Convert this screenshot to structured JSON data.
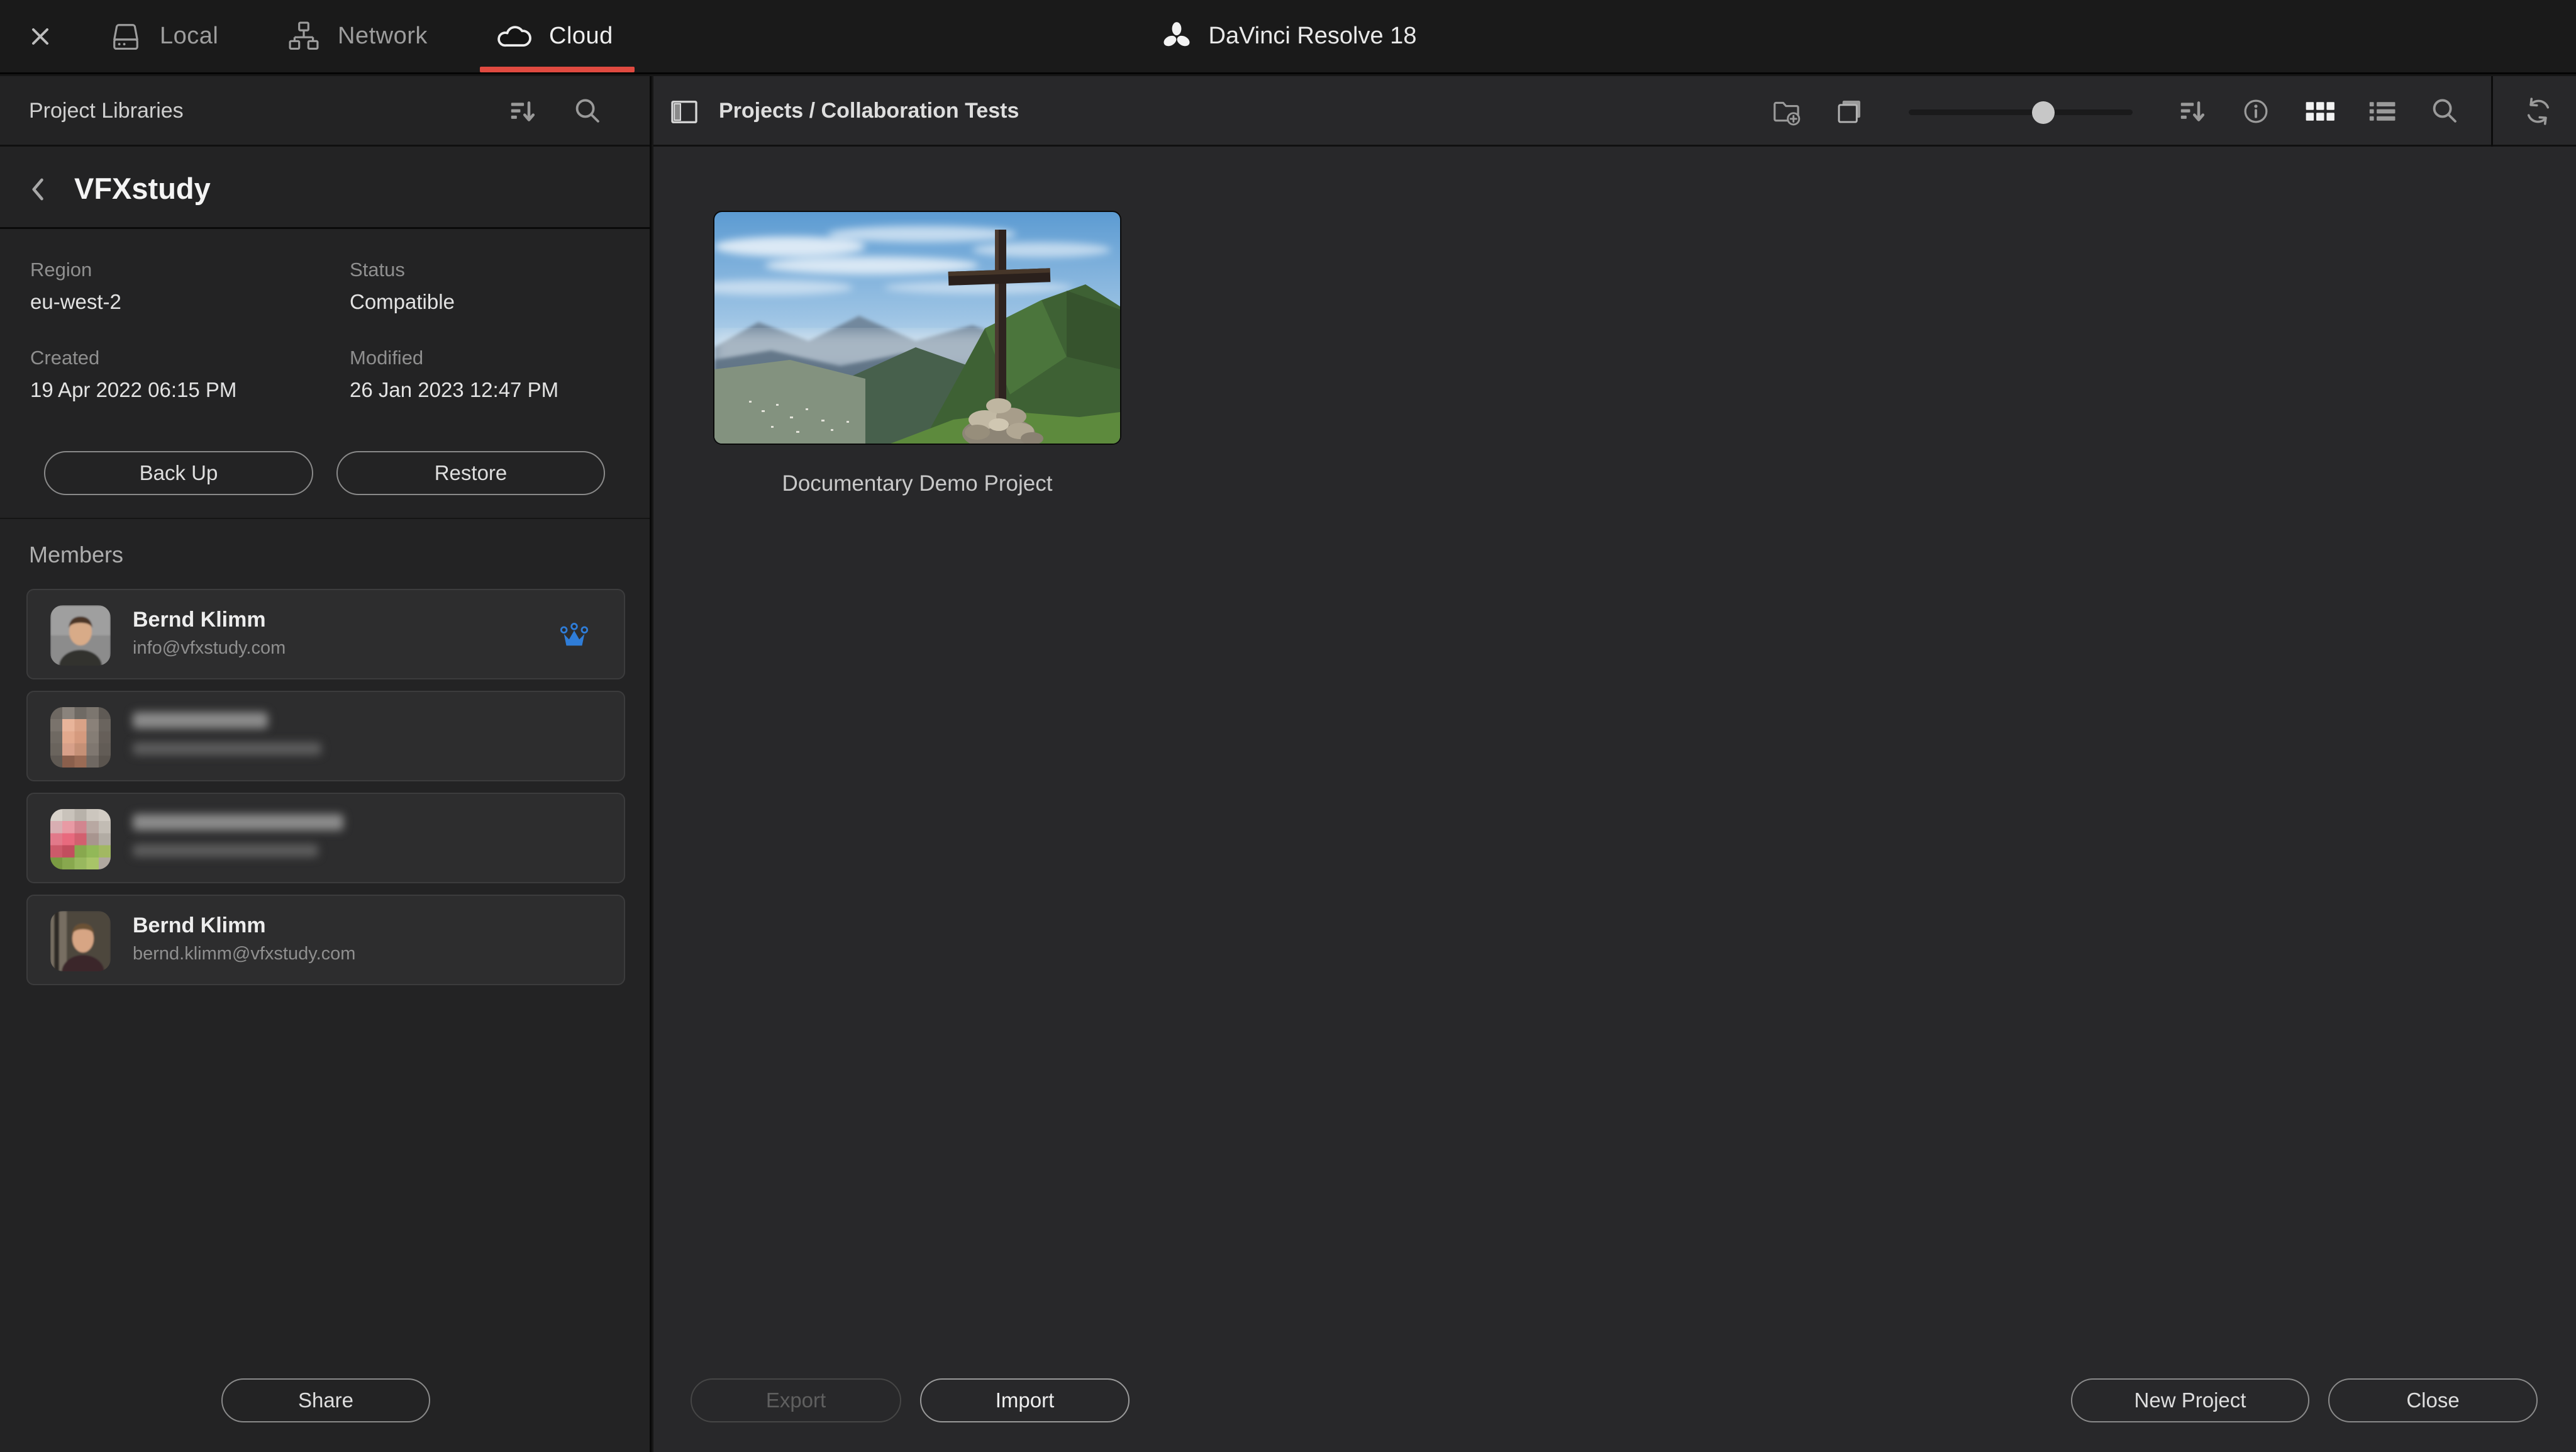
{
  "window": {
    "title": "DaVinci Resolve 18"
  },
  "tabs": [
    {
      "label": "Local",
      "active": false
    },
    {
      "label": "Network",
      "active": false
    },
    {
      "label": "Cloud",
      "active": true
    }
  ],
  "left_panel": {
    "header": "Project Libraries",
    "library": {
      "name": "VFXstudy",
      "fields": [
        {
          "label": "Region",
          "value": "eu-west-2"
        },
        {
          "label": "Status",
          "value": "Compatible"
        },
        {
          "label": "Created",
          "value": "19 Apr 2022 06:15 PM"
        },
        {
          "label": "Modified",
          "value": "26 Jan 2023 12:47 PM"
        }
      ],
      "backup_label": "Back Up",
      "restore_label": "Restore"
    },
    "members": {
      "title": "Members",
      "items": [
        {
          "name": "Bernd Klimm",
          "email": "info@vfxstudy.com",
          "owner": true,
          "redacted": false
        },
        {
          "name": "",
          "email": "",
          "owner": false,
          "redacted": true
        },
        {
          "name": "",
          "email": "",
          "owner": false,
          "redacted": true
        },
        {
          "name": "Bernd Klimm",
          "email": "bernd.klimm@vfxstudy.com",
          "owner": false,
          "redacted": false
        }
      ]
    },
    "share_label": "Share"
  },
  "right_panel": {
    "breadcrumb": "Projects / Collaboration Tests",
    "projects": [
      {
        "title": "Documentary Demo Project"
      }
    ],
    "zoom_slider_pct": 60,
    "footer": {
      "export_label": "Export",
      "import_label": "Import",
      "new_project_label": "New Project",
      "close_label": "Close"
    }
  },
  "icons": {
    "topbar": [
      "close-icon",
      "drive-icon",
      "network-icon",
      "cloud-icon",
      "davinci-logo"
    ],
    "left_header": [
      "sort-icon",
      "search-icon"
    ],
    "library": [
      "chevron-left-icon"
    ],
    "member_badge": "crown-icon",
    "right_header": [
      "panel-toggle-icon",
      "new-folder-icon",
      "preview-toggle-icon",
      "zoom-slider",
      "sort-icon",
      "info-icon",
      "grid-view-icon",
      "list-view-icon",
      "search-icon",
      "refresh-icon"
    ]
  },
  "colors": {
    "accent_red": "#e04a40",
    "owner_blue": "#2f7dd8"
  }
}
